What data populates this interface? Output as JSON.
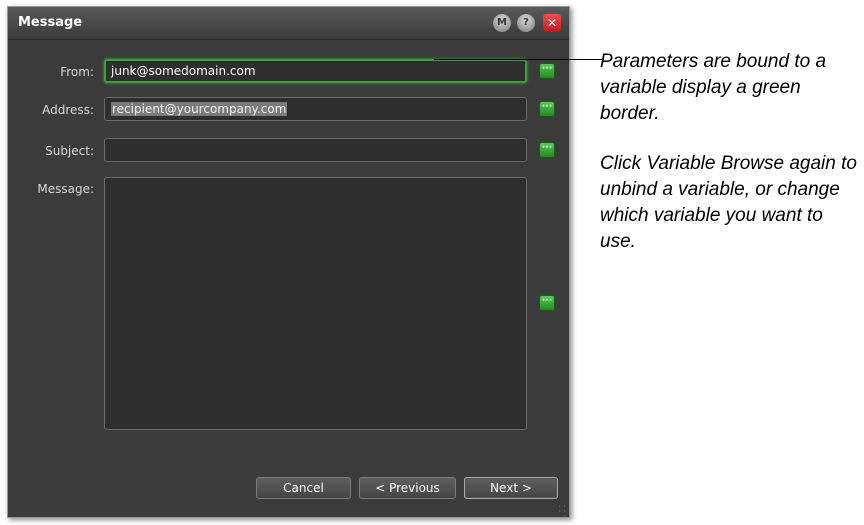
{
  "dialog": {
    "title": "Message",
    "title_buttons": {
      "macro_label": "M",
      "help_label": "?",
      "close_label": "✕"
    }
  },
  "form": {
    "from": {
      "label": "From:",
      "value": "junk@somedomain.com",
      "bound_to_variable": true
    },
    "address": {
      "label": "Address:",
      "value": "recipient@yourcompany.com",
      "bound_to_variable": false
    },
    "subject": {
      "label": "Subject:",
      "value": "",
      "bound_to_variable": false
    },
    "message": {
      "label": "Message:",
      "value": "",
      "bound_to_variable": false
    },
    "variable_browse_label": "···"
  },
  "footer": {
    "cancel_label": "Cancel",
    "previous_label": "< Previous",
    "next_label": "Next >"
  },
  "annotation": {
    "note1": "Parameters are bound to a variable display a green border.",
    "note2": "Click Variable Browse again to unbind a variable, or change which variable you want to use."
  },
  "colors": {
    "bound_border": "#3aa13a",
    "variable_button": "#2e9e2e",
    "dialog_bg": "#3b3b3b",
    "field_bg": "#2e2e2e"
  }
}
